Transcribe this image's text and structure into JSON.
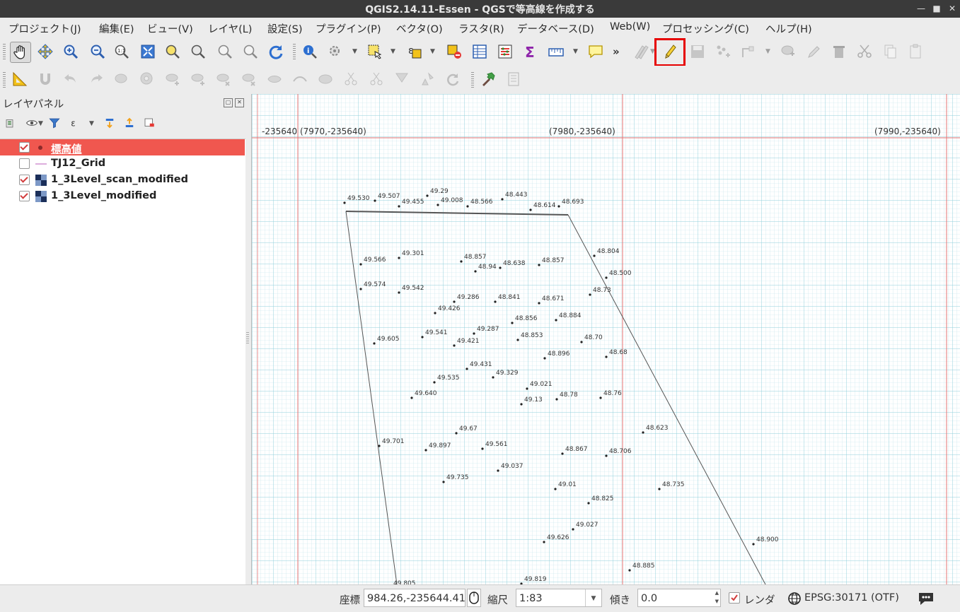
{
  "window": {
    "title": "QGIS2.14.11-Essen - QGSで等高線を作成する"
  },
  "menu": [
    {
      "label": "プロジェクト(J)"
    },
    {
      "label": "編集(E)"
    },
    {
      "label": "ビュー(V)"
    },
    {
      "label": "レイヤ(L)"
    },
    {
      "label": "設定(S)"
    },
    {
      "label": "プラグイン(P)"
    },
    {
      "label": "ベクタ(O)"
    },
    {
      "label": "ラスタ(R)"
    },
    {
      "label": "データベース(D)"
    },
    {
      "label": "Web(W)"
    },
    {
      "label": "プロセッシング(C)"
    },
    {
      "label": "ヘルプ(H)"
    }
  ],
  "toolbar": {
    "overflow": "»"
  },
  "layers_panel": {
    "title": "レイヤパネル",
    "layers": [
      {
        "name": "標高値",
        "checked": true,
        "selected": true,
        "icon": "point-layer-icon"
      },
      {
        "name": "TJ12_Grid",
        "checked": false,
        "selected": false,
        "icon": "line-layer-icon"
      },
      {
        "name": "1_3Level_scan_modified",
        "checked": true,
        "selected": false,
        "icon": "raster-layer-icon"
      },
      {
        "name": "1_3Level_modified",
        "checked": true,
        "selected": false,
        "icon": "raster-layer-icon"
      }
    ]
  },
  "map": {
    "header_labels": [
      "-235640 (7970,-235640)",
      "(7980,-235640)",
      "(7990,-235640)"
    ],
    "elevations": [
      {
        "t": "49.530"
      },
      {
        "t": "49.507"
      },
      {
        "t": "49.455"
      },
      {
        "t": "49.29"
      },
      {
        "t": "49.008"
      },
      {
        "t": "48.566"
      },
      {
        "t": "48.443"
      },
      {
        "t": "48.614"
      },
      {
        "t": "48.693"
      },
      {
        "t": "49.301"
      },
      {
        "t": "49.566"
      },
      {
        "t": "48.857"
      },
      {
        "t": "48.94"
      },
      {
        "t": "48.638"
      },
      {
        "t": "48.857"
      },
      {
        "t": "48.804"
      },
      {
        "t": "48.500"
      },
      {
        "t": "49.574"
      },
      {
        "t": "49.542"
      },
      {
        "t": "48.73"
      },
      {
        "t": "49.286"
      },
      {
        "t": "48.841"
      },
      {
        "t": "48.671"
      },
      {
        "t": "49.426"
      },
      {
        "t": "48.856"
      },
      {
        "t": "48.884"
      },
      {
        "t": "49.287"
      },
      {
        "t": "49.541"
      },
      {
        "t": "48.853"
      },
      {
        "t": "48.70"
      },
      {
        "t": "49.605"
      },
      {
        "t": "49.421"
      },
      {
        "t": "48.68"
      },
      {
        "t": "48.896"
      },
      {
        "t": "49.431"
      },
      {
        "t": "49.329"
      },
      {
        "t": "49.535"
      },
      {
        "t": "49.021"
      },
      {
        "t": "49.640"
      },
      {
        "t": "48.78"
      },
      {
        "t": "48.76"
      },
      {
        "t": "49.13"
      },
      {
        "t": "48.623"
      },
      {
        "t": "49.67"
      },
      {
        "t": "49.701"
      },
      {
        "t": "49.897"
      },
      {
        "t": "49.561"
      },
      {
        "t": "48.867"
      },
      {
        "t": "48.706"
      },
      {
        "t": "49.037"
      },
      {
        "t": "49.735"
      },
      {
        "t": "48.735"
      },
      {
        "t": "49.01"
      },
      {
        "t": "48.825"
      },
      {
        "t": "49.027"
      },
      {
        "t": "49.626"
      },
      {
        "t": "48.900"
      },
      {
        "t": "48.885"
      },
      {
        "t": "49.819"
      },
      {
        "t": "49.805"
      }
    ]
  },
  "status": {
    "coord_label": "座標",
    "coord_value": "984.26,-235644.41",
    "scale_label": "縮尺",
    "scale_value": "1:83",
    "rotation_label": "傾き",
    "rotation_value": "0.0",
    "render_label": "レンダ",
    "crs": "EPSG:30171 (OTF)"
  }
}
